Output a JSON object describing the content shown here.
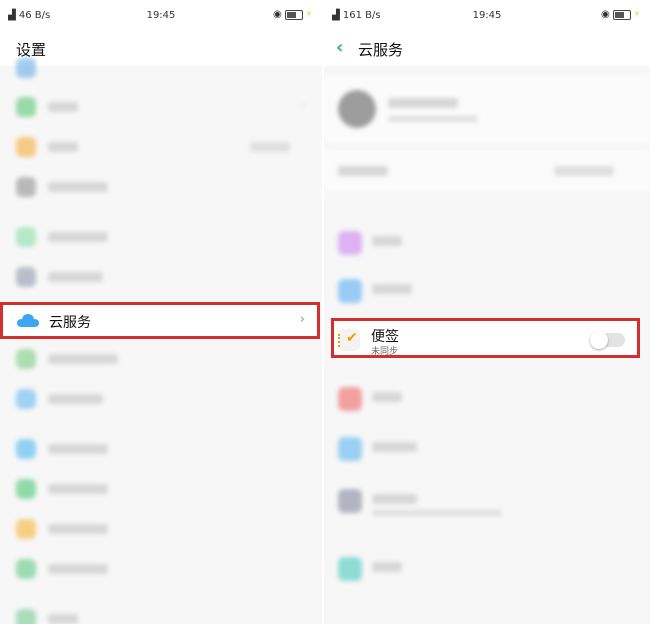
{
  "left_screen": {
    "status": {
      "network": "46 B/s",
      "time": "19:45"
    },
    "title": "设置",
    "highlighted_item": {
      "label": "云服务",
      "icon": "cloud-icon",
      "arrow": "›"
    }
  },
  "right_screen": {
    "status": {
      "network": "161 B/s",
      "time": "19:45"
    },
    "back_icon": "‹",
    "title": "云服务",
    "highlighted_item": {
      "label": "便签",
      "sub": "未同步",
      "icon": "note-icon",
      "toggle": "off"
    }
  },
  "colors": {
    "highlight_border": "#d32f2f",
    "back_arrow": "#2bb673",
    "cloud": "#3aa7f0"
  }
}
